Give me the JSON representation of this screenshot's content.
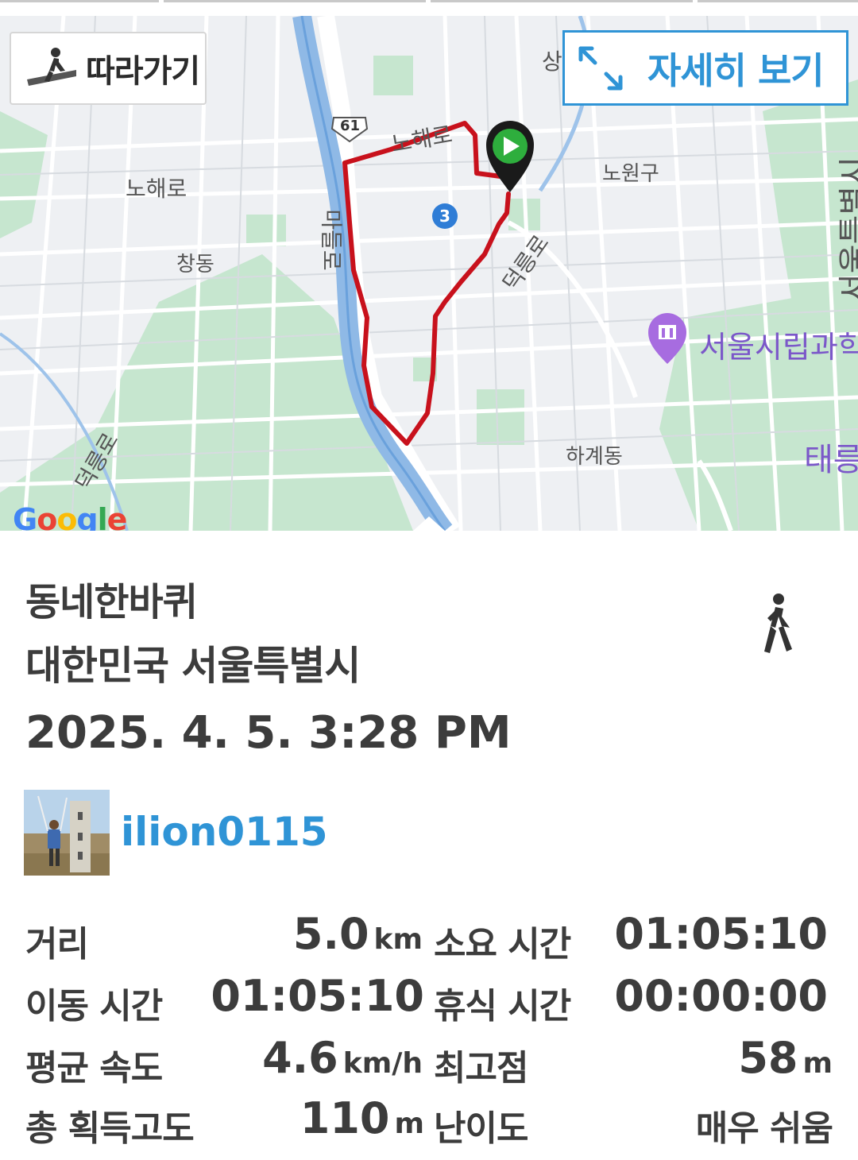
{
  "map": {
    "follow_label": "따라가기",
    "detail_label": "자세히 보기",
    "labels": {
      "nohaero_top": "노해로",
      "nohaero_left": "노해로",
      "route61": "61",
      "madeullo": "마들로",
      "changdong": "창동",
      "subway3": "3",
      "nowongu": "노원구",
      "deongneungno_right": "덕릉로",
      "deongneungno_left": "덕릉로",
      "seoul_teukbyeol": "서울특별시",
      "poi_science": "서울시립과학",
      "hagyedong": "하계동",
      "taereung": "태릉",
      "sang": "상",
      "google": "Google"
    },
    "route_color": "#c8111c"
  },
  "activity": {
    "title": "동네한바퀴",
    "location": "대한민국 서울특별시",
    "datetime": "2025. 4. 5. 3:28 PM",
    "activity_icon": "walking-person-icon",
    "username": "ilion0115"
  },
  "stats": [
    {
      "label": "거리",
      "value": "5.0",
      "unit": "km"
    },
    {
      "label": "소요 시간",
      "value": "01:05:10",
      "unit": ""
    },
    {
      "label": "이동 시간",
      "value": "01:05:10",
      "unit": ""
    },
    {
      "label": "휴식 시간",
      "value": "00:00:00",
      "unit": ""
    },
    {
      "label": "평균 속도",
      "value": "4.6",
      "unit": "km/h"
    },
    {
      "label": "최고점",
      "value": "58",
      "unit": "m"
    },
    {
      "label": "총 획득고도",
      "value": "110",
      "unit": "m"
    },
    {
      "label": "난이도",
      "value": "매우 쉬움",
      "unit": ""
    }
  ],
  "colors": {
    "accent": "#2f94d6",
    "text": "#3c3c3c",
    "map_green": "#c4e7cf",
    "river": "#8fb9e6"
  }
}
